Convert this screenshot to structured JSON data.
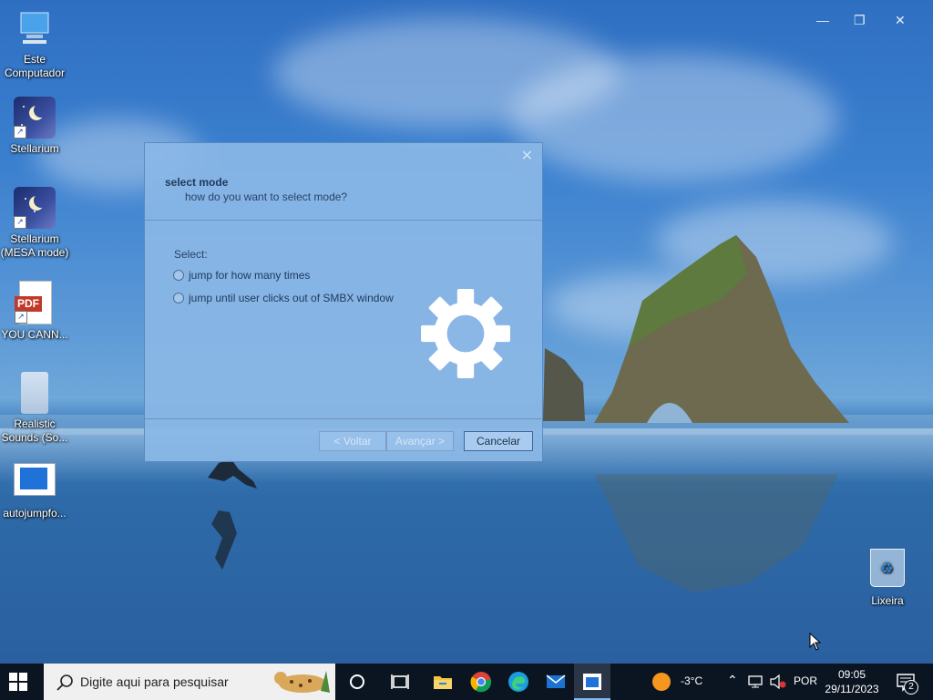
{
  "desktop": {
    "icons": [
      {
        "label": "Este Computador",
        "icon": "computer-icon"
      },
      {
        "label": "Stellarium",
        "icon": "stellarium-icon"
      },
      {
        "label": "Stellarium (MESA mode)",
        "icon": "stellarium-icon"
      },
      {
        "label": "YOU CANN...",
        "icon": "pdf-icon",
        "badge": "PDF"
      },
      {
        "label": "Realistic Sounds (So...",
        "icon": "folder-icon"
      },
      {
        "label": "autojumpfo...",
        "icon": "app-window-icon"
      },
      {
        "label": "Lixeira",
        "icon": "recycle-bin-icon"
      }
    ]
  },
  "dialog": {
    "title": "select mode",
    "subtitle": "how do you want to select mode?",
    "select_label": "Select:",
    "options": [
      {
        "label": "jump for how many times",
        "selected": false
      },
      {
        "label": "jump until user clicks out of SMBX window",
        "selected": false
      }
    ],
    "buttons": {
      "back": "< Voltar",
      "next": "Avançar >",
      "cancel": "Cancelar"
    }
  },
  "taskbar": {
    "search_placeholder": "Digite aqui para pesquisar",
    "pinned": [
      "cortana-icon",
      "task-view-icon",
      "file-explorer-icon",
      "chrome-icon",
      "edge-icon",
      "mail-icon",
      "active-app-icon"
    ],
    "weather": "-3°C",
    "language": "POR",
    "time": "09:05",
    "date": "29/11/2023",
    "notification_count": "2"
  },
  "colors": {
    "taskbar": "#0b1522",
    "dialog": "#8ab7e6",
    "accent": "#1e72d8"
  }
}
